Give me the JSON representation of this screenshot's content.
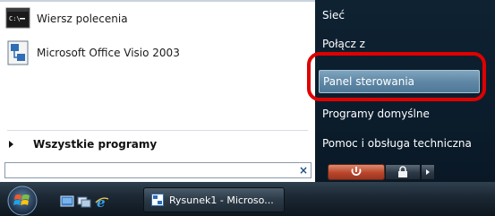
{
  "programs": {
    "items": [
      {
        "label": "Wiersz polecenia",
        "icon": "cmd-icon"
      },
      {
        "label": "Microsoft Office Visio 2003",
        "icon": "visio-icon"
      }
    ],
    "all_programs_label": "Wszystkie programy"
  },
  "search": {
    "value": "",
    "clear_glyph": "×"
  },
  "right_menu": {
    "items": [
      {
        "label": "Sieć"
      },
      {
        "label": "Połącz z"
      },
      {
        "label": "Panel sterowania",
        "highlighted": true
      },
      {
        "label": "Programy domyślne"
      },
      {
        "label": "Pomoc i obsługa techniczna"
      }
    ]
  },
  "power": {
    "power_icon": "power-icon",
    "lock_icon": "lock-icon",
    "arrow_icon": "arrow-right-icon"
  },
  "taskbar": {
    "task_label": "Rysunek1 - Microso...",
    "quick_launch": [
      "show-desktop-icon",
      "switch-windows-icon",
      "ie-icon"
    ]
  },
  "colors": {
    "highlight": "#6f97b3",
    "annotation_ring": "#e00000",
    "power_button": "#b8462b"
  }
}
